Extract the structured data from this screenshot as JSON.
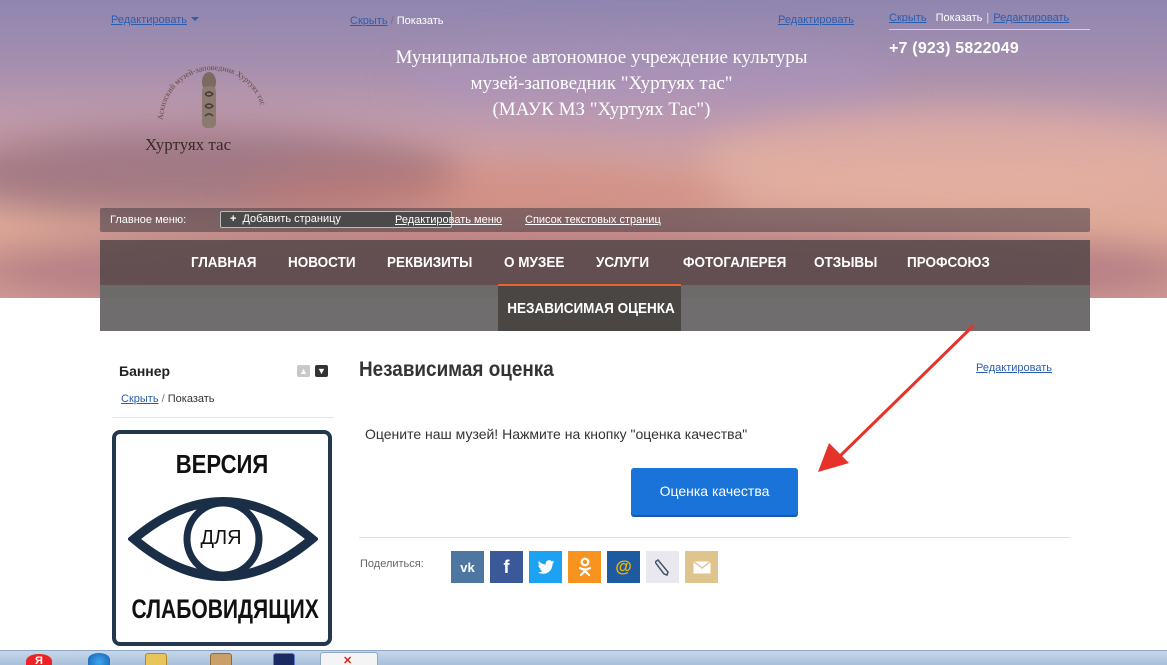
{
  "header": {
    "edit_top_left": "Редактировать",
    "hide_label": "Скрыть",
    "show_label": "Показать",
    "edit_top_mid": "Редактировать",
    "right_hide": "Скрыть",
    "right_show": "Показать",
    "right_edit": "Редактировать",
    "phone": "+7 (923) 5822049",
    "org_line1": "Муниципальное автономное учреждение культуры",
    "org_line2": "музей-заповедник \"Хуртуях тас\"",
    "org_line3": "(МАУК МЗ \"Хуртуях Тас\")",
    "logo_text": "Хуртуях тас",
    "logo_ring_text": "Аскизский музей-заповедник Хуртуях тас"
  },
  "adminbar": {
    "label": "Главное меню:",
    "add_page": "Добавить страницу",
    "edit_menu": "Редактировать меню",
    "text_pages": "Список текстовых страниц"
  },
  "nav": {
    "items": [
      "ГЛАВНАЯ",
      "НОВОСТИ",
      "РЕКВИЗИТЫ",
      "О МУЗЕЕ",
      "УСЛУГИ",
      "ФОТОГАЛЕРЕЯ",
      "ОТЗЫВЫ",
      "ПРОФСОЮЗ"
    ],
    "active": "О МУЗЕЕ",
    "sub_item": "НЕЗАВИСИМАЯ ОЦЕНКА",
    "accent_color": "#e8642c"
  },
  "sidebar": {
    "title": "Баннер",
    "hide": "Скрыть",
    "show": "Показать",
    "banner_top": "ВЕРСИЯ",
    "banner_mid": "ДЛЯ",
    "banner_bottom": "СЛАБОВИДЯЩИХ"
  },
  "content": {
    "title": "Независимая оценка",
    "edit": "Редактировать",
    "intro": "Оцените наш музей! Нажмите на кнопку \"оценка качества\"",
    "cta": "Оценка качества",
    "cta_color": "#1a73d8",
    "share_label": "Поделиться:",
    "share_icons": [
      "vk-icon",
      "facebook-icon",
      "twitter-icon",
      "odnoklassniki-icon",
      "mailru-icon",
      "livejournal-icon",
      "email-icon"
    ]
  },
  "taskbar": {
    "yandex": "Я"
  }
}
